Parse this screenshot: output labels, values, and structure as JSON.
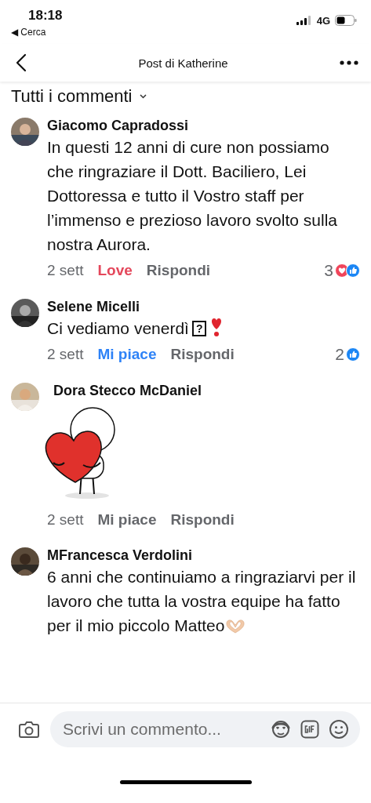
{
  "status_bar": {
    "time": "18:18",
    "back_label": "◀ Cerca",
    "network": "4G"
  },
  "nav": {
    "title": "Post di Katherine"
  },
  "section": {
    "title": "Tutti i commenti"
  },
  "comments": [
    {
      "author": "Giacomo Capradossi",
      "kind": "text",
      "body": "In questi 12 anni di cure non possiamo che ringraziare il Dott. Baciliero, Lei Dottoressa e tutto il Vostro staff per l’immenso e prezioso lavoro svolto sulla nostra Aurora.",
      "time": "2 sett",
      "reaction": {
        "label": "Love",
        "kind": "love",
        "reacted": true
      },
      "reply": "Rispondi",
      "count": "3",
      "count_icons": [
        {
          "kind": "love"
        },
        {
          "kind": "like"
        }
      ]
    },
    {
      "author": "Selene Micelli",
      "kind": "text",
      "body": "Ci vediamo venerdì",
      "trailing": [
        {
          "kind": "missing_glyph",
          "text": "?"
        },
        {
          "kind": "heart_exclamation"
        }
      ],
      "time": "2 sett",
      "reaction": {
        "label": "Mi piace",
        "kind": "like",
        "reacted": true
      },
      "reply": "Rispondi",
      "count": "2",
      "count_icons": [
        {
          "kind": "like"
        }
      ]
    },
    {
      "author": "Dora Stecco McDaniel",
      "kind": "sticker",
      "time": "2 sett",
      "reaction": {
        "label": "Mi piace",
        "reacted": false
      },
      "reply": "Rispondi"
    },
    {
      "author": "MFrancesca Verdolini",
      "kind": "text",
      "body": "6 anni che continuiamo a ringraziarvi per il lavoro che tutta la vostra equipe ha fatto per il mio piccolo Matteo",
      "trailing": [
        {
          "kind": "heart_hands"
        }
      ]
    }
  ],
  "composer": {
    "placeholder": "Scrivi un commento..."
  }
}
